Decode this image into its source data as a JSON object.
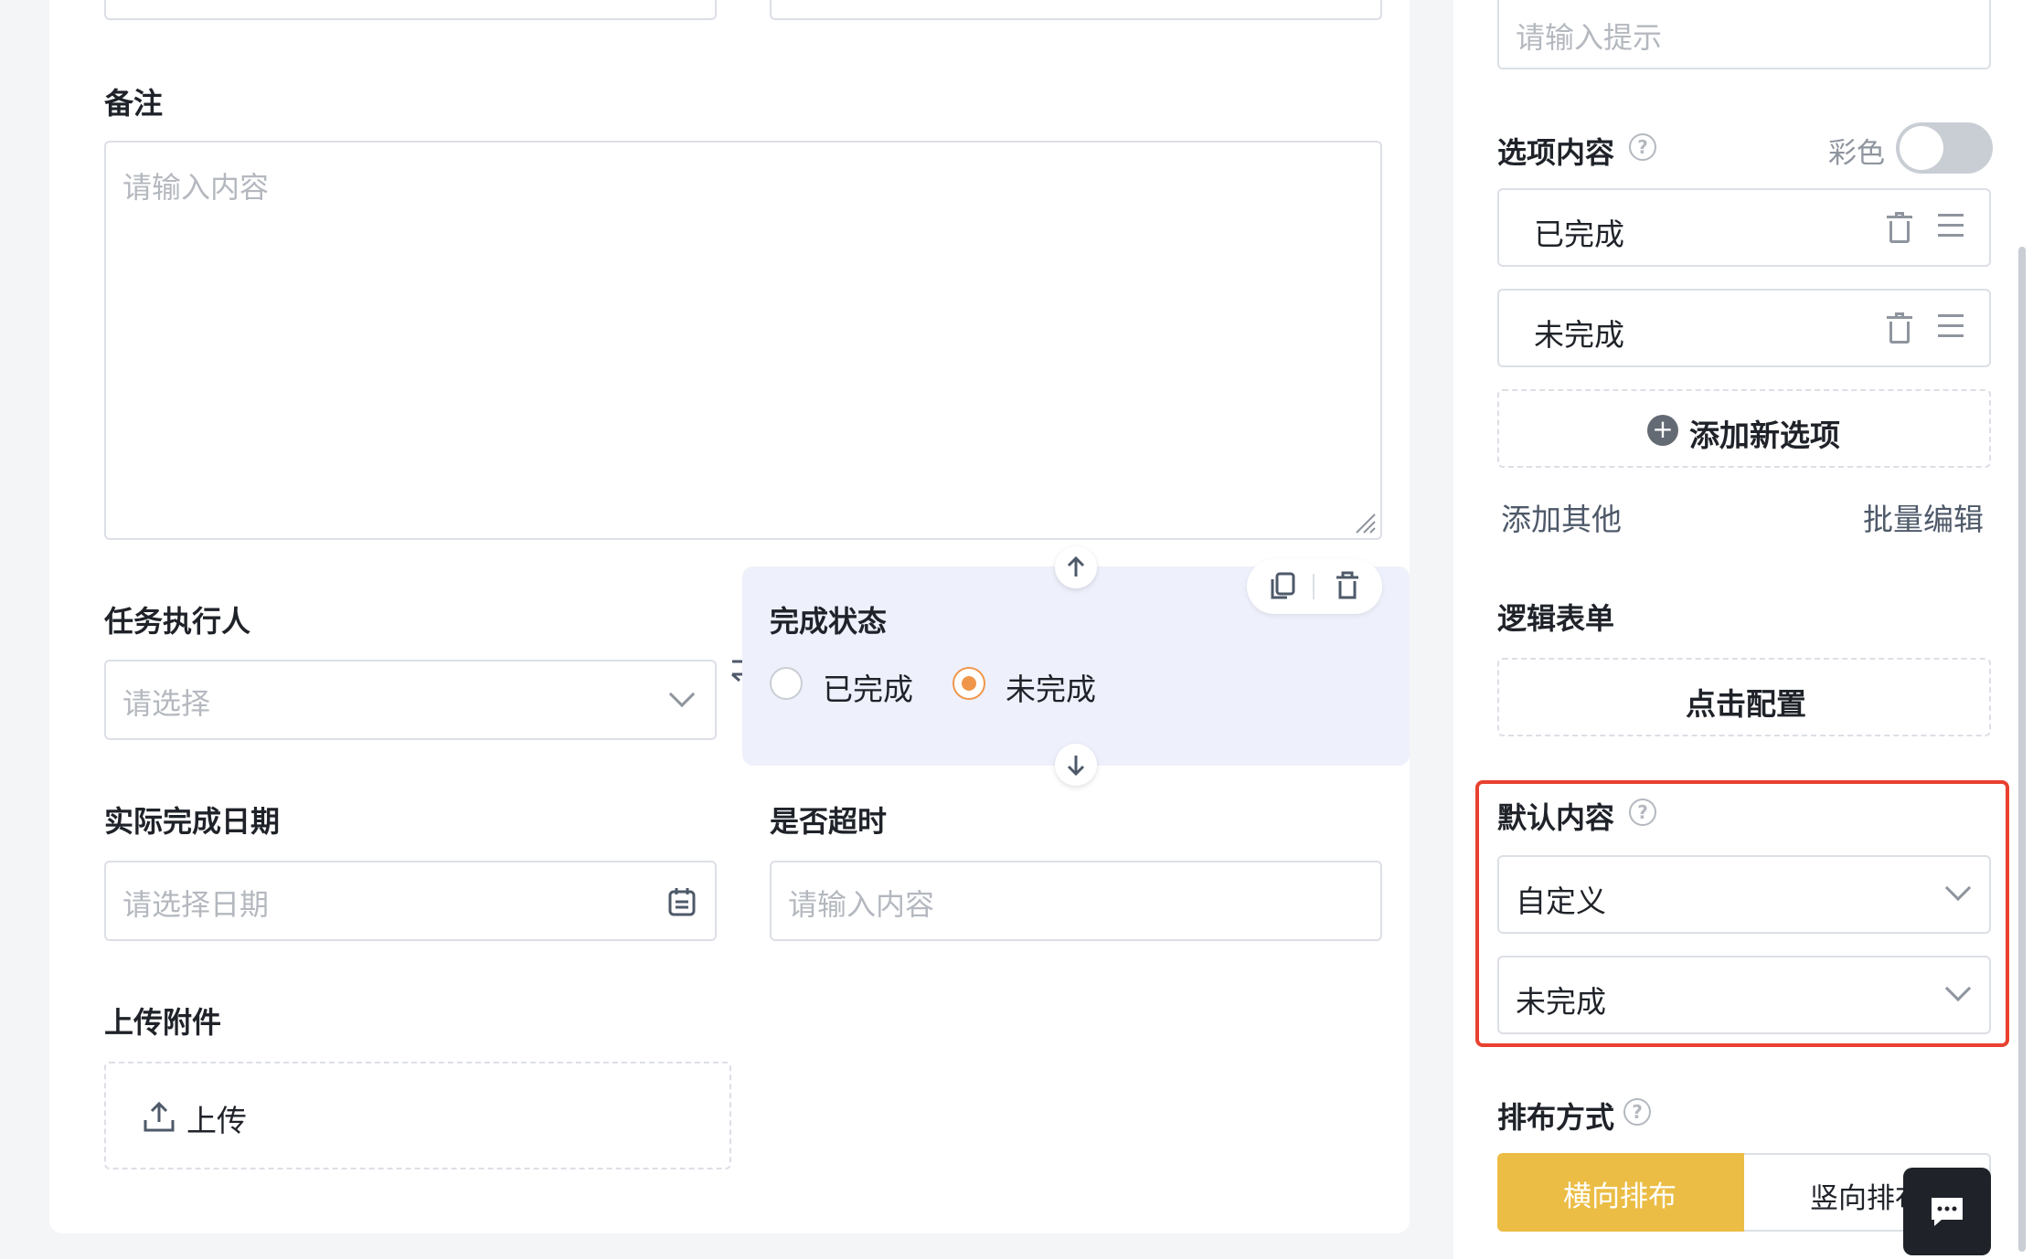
{
  "form": {
    "remark": {
      "label": "备注",
      "placeholder": "请输入内容"
    },
    "assignee": {
      "label": "任务执行人",
      "placeholder": "请选择"
    },
    "status": {
      "label": "完成状态",
      "options": [
        "已完成",
        "未完成"
      ],
      "selected": "未完成"
    },
    "finish_date": {
      "label": "实际完成日期",
      "placeholder": "请选择日期"
    },
    "overdue": {
      "label": "是否超时",
      "placeholder": "请输入内容"
    },
    "attachment": {
      "label": "上传附件",
      "upload_label": "上传"
    }
  },
  "panel": {
    "hint": {
      "placeholder": "请输入提示"
    },
    "options_section": {
      "label": "选项内容",
      "color_label": "彩色",
      "color_enabled": false,
      "items": [
        "已完成",
        "未完成"
      ],
      "add_option": "添加新选项",
      "add_other": "添加其他",
      "batch_edit": "批量编辑"
    },
    "logic_form": {
      "label": "逻辑表单",
      "configure": "点击配置"
    },
    "default_content": {
      "label": "默认内容",
      "mode": "自定义",
      "value": "未完成"
    },
    "arrangement": {
      "label": "排布方式",
      "horizontal": "横向排布",
      "vertical": "竖向排布"
    }
  },
  "colors": {
    "accent_orange": "#f0964a",
    "highlight_red": "#e8412f",
    "button_yellow": "#ebbd45",
    "selected_field_bg": "#eef0fb"
  }
}
